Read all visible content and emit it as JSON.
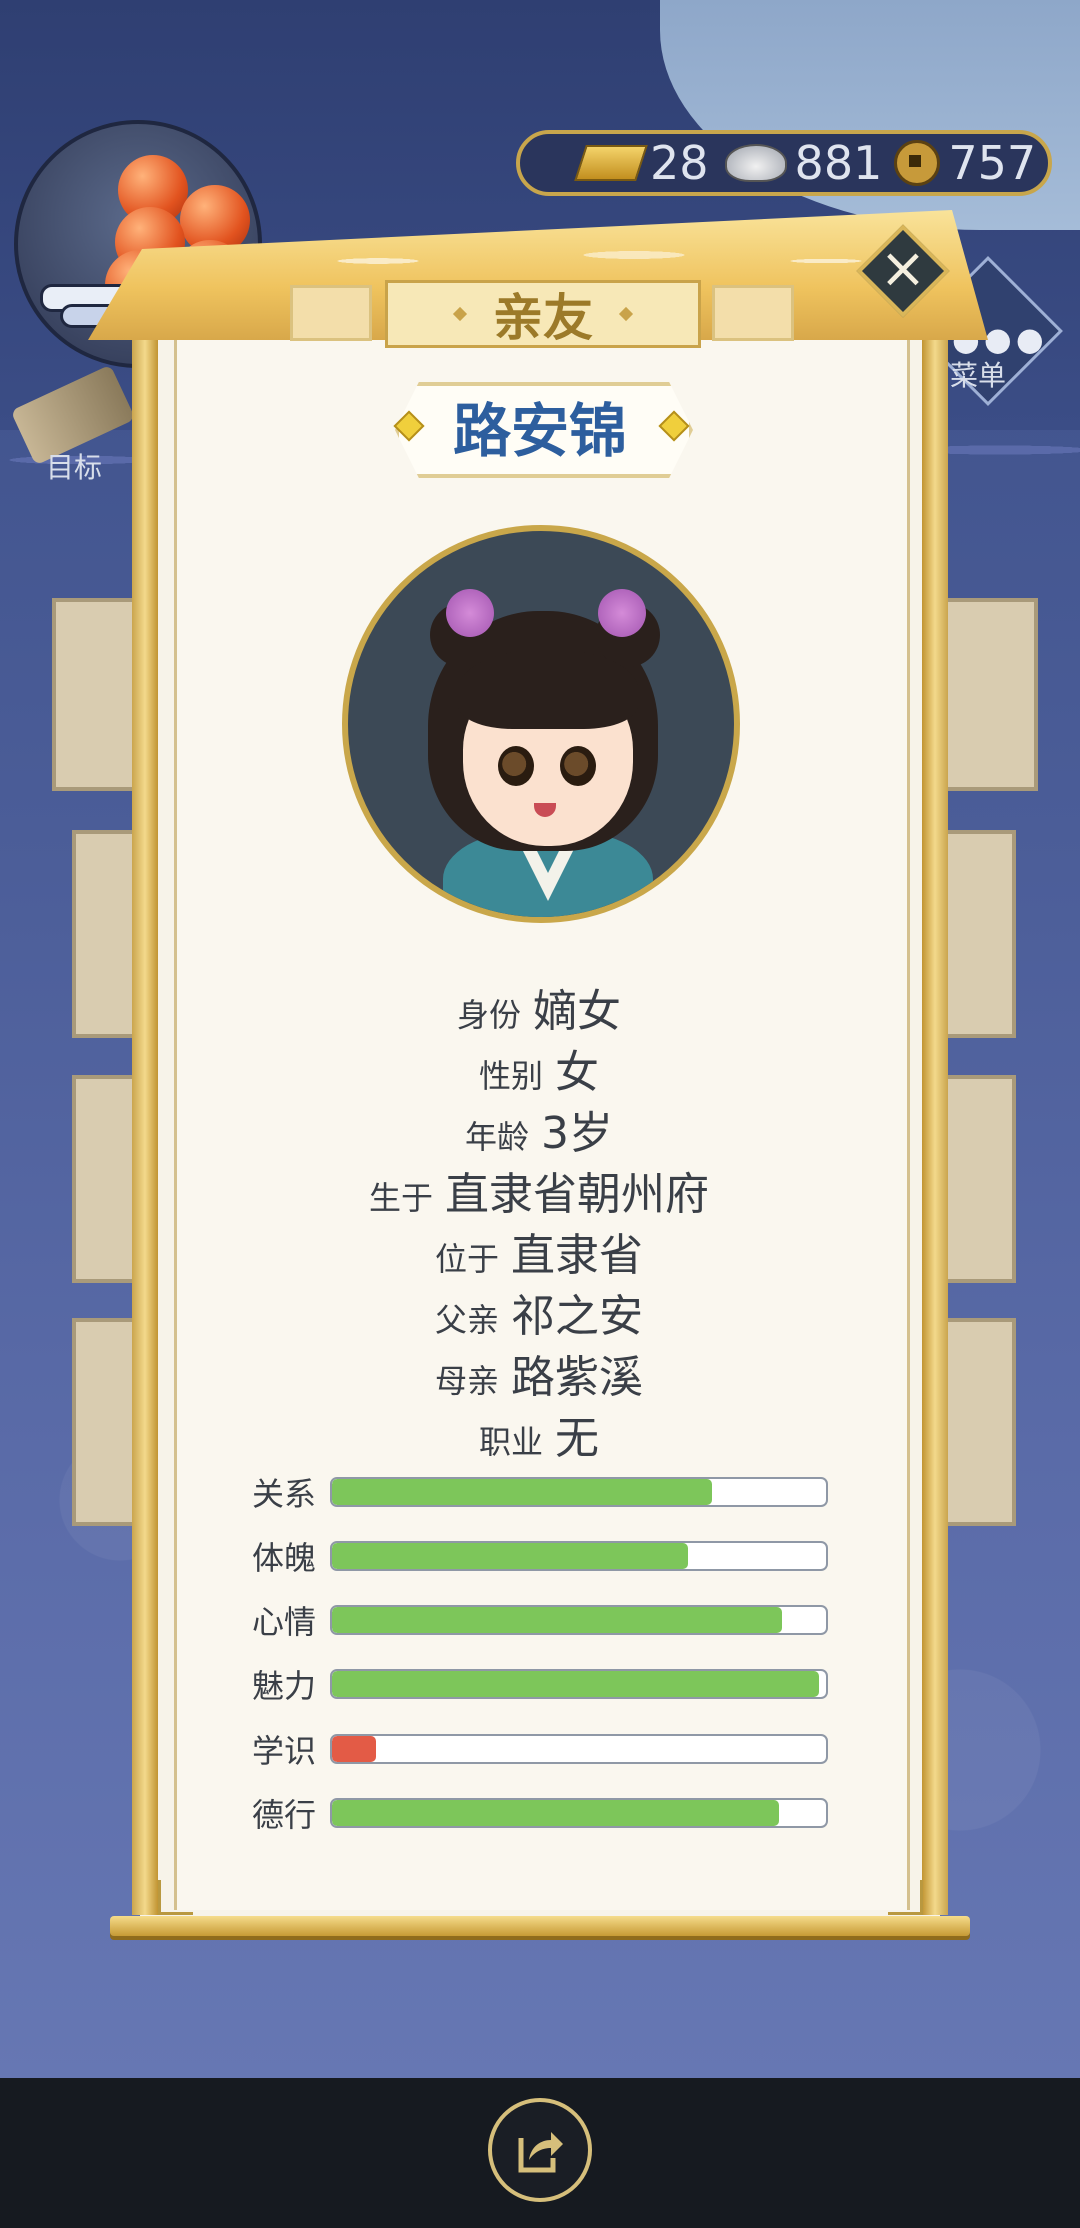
{
  "hud": {
    "gold": "28",
    "silver": "881",
    "coins": "757",
    "target_label": "目标",
    "menu_label": "菜单"
  },
  "popup": {
    "title": "亲友",
    "name": "路安锦",
    "info": [
      {
        "label": "身份",
        "value": "嫡女"
      },
      {
        "label": "性别",
        "value": "女"
      },
      {
        "label": "年龄",
        "value": "3岁"
      },
      {
        "label": "生于",
        "value": "直隶省朝州府"
      },
      {
        "label": "位于",
        "value": "直隶省"
      },
      {
        "label": "父亲",
        "value": "祁之安"
      },
      {
        "label": "母亲",
        "value": "路紫溪"
      },
      {
        "label": "职业",
        "value": "无"
      }
    ],
    "stats": [
      {
        "label": "关系",
        "value": 0.77,
        "color": "#7dc65a"
      },
      {
        "label": "体魄",
        "value": 0.72,
        "color": "#7dc65a"
      },
      {
        "label": "心情",
        "value": 0.91,
        "color": "#7dc65a"
      },
      {
        "label": "魅力",
        "value": 0.985,
        "color": "#7dc65a"
      },
      {
        "label": "学识",
        "value": 0.09,
        "color": "#e35b46"
      },
      {
        "label": "德行",
        "value": 0.905,
        "color": "#7dc65a"
      }
    ]
  },
  "colors": {
    "accent_gold": "#c9a74a",
    "name_blue": "#2d5e9e",
    "bar_green": "#7dc65a",
    "bar_red": "#e35b46"
  },
  "icons": {
    "close": "close-icon",
    "share": "share-icon",
    "gold": "gold-ingot-icon",
    "silver": "silver-ingot-icon",
    "coin": "copper-coin-icon"
  }
}
